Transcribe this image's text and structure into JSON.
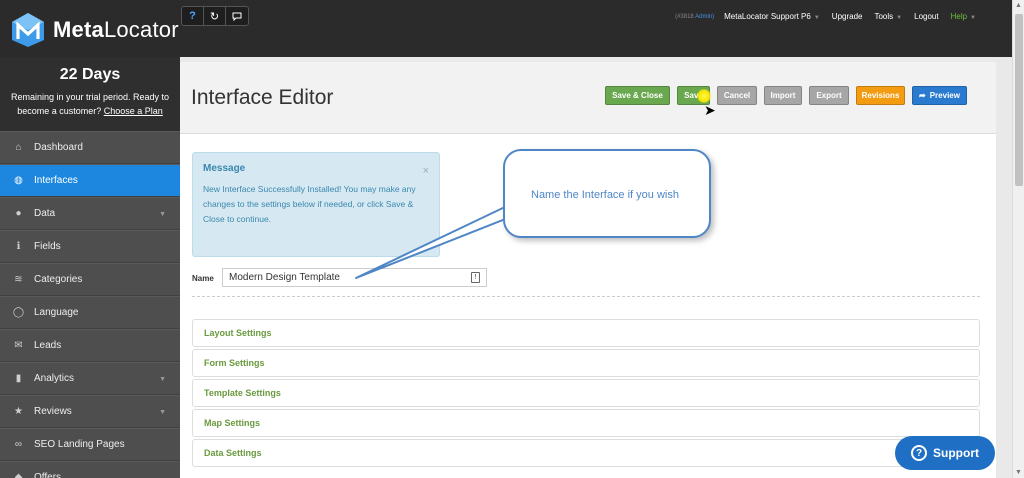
{
  "brand": {
    "name_bold": "Meta",
    "name_rest": "Locator"
  },
  "toolbar": {
    "help_icon": "question-icon",
    "refresh_icon": "refresh-icon",
    "chat_icon": "chat-icon"
  },
  "topnav": {
    "account_id": "(#3818",
    "account_role": "Admin)",
    "account_name": "MetaLocator Support P6",
    "upgrade": "Upgrade",
    "tools": "Tools",
    "logout": "Logout",
    "help": "Help"
  },
  "trial": {
    "days": "22 Days",
    "text": "Remaining in your trial period. Ready to become a customer?",
    "link": "Choose a Plan"
  },
  "sidebar": {
    "items": [
      {
        "label": "Dashboard",
        "icon": "home-icon",
        "glyph": "⌂",
        "active": false,
        "has_caret": false
      },
      {
        "label": "Interfaces",
        "icon": "globe-icon",
        "glyph": "◍",
        "active": true,
        "has_caret": false
      },
      {
        "label": "Data",
        "icon": "map-marker-icon",
        "glyph": "●",
        "active": false,
        "has_caret": true
      },
      {
        "label": "Fields",
        "icon": "info-icon",
        "glyph": "ℹ",
        "active": false,
        "has_caret": false
      },
      {
        "label": "Categories",
        "icon": "layers-icon",
        "glyph": "≋",
        "active": false,
        "has_caret": false
      },
      {
        "label": "Language",
        "icon": "speech-icon",
        "glyph": "◯",
        "active": false,
        "has_caret": false
      },
      {
        "label": "Leads",
        "icon": "envelope-icon",
        "glyph": "✉",
        "active": false,
        "has_caret": false
      },
      {
        "label": "Analytics",
        "icon": "bar-chart-icon",
        "glyph": "▮",
        "active": false,
        "has_caret": true
      },
      {
        "label": "Reviews",
        "icon": "star-icon",
        "glyph": "★",
        "active": false,
        "has_caret": true
      },
      {
        "label": "SEO Landing Pages",
        "icon": "link-icon",
        "glyph": "∞",
        "active": false,
        "has_caret": false
      },
      {
        "label": "Offers",
        "icon": "tag-icon",
        "glyph": "◆",
        "active": false,
        "has_caret": false
      }
    ]
  },
  "page": {
    "title": "Interface Editor"
  },
  "actions": {
    "save_close": "Save & Close",
    "save": "Save",
    "cancel": "Cancel",
    "import": "Import",
    "export": "Export",
    "revisions": "Revisions",
    "preview": "Preview"
  },
  "message": {
    "title": "Message",
    "close": "×",
    "body": "New Interface Successfully Installed! You may make any changes to the settings below if needed, or click Save & Close to continue."
  },
  "callout": {
    "text": "Name the Interface if you wish"
  },
  "name_field": {
    "label": "Name",
    "value": "Modern Design Template"
  },
  "settings": [
    {
      "label": "Layout Settings"
    },
    {
      "label": "Form Settings"
    },
    {
      "label": "Template Settings"
    },
    {
      "label": "Map Settings"
    },
    {
      "label": "Data Settings"
    }
  ],
  "support": {
    "label": "Support",
    "icon": "question-icon"
  },
  "colors": {
    "accent_blue": "#1d87e0",
    "green_button": "#6aa84f",
    "orange_button": "#f39c12",
    "settings_text": "#6a9a3f"
  }
}
